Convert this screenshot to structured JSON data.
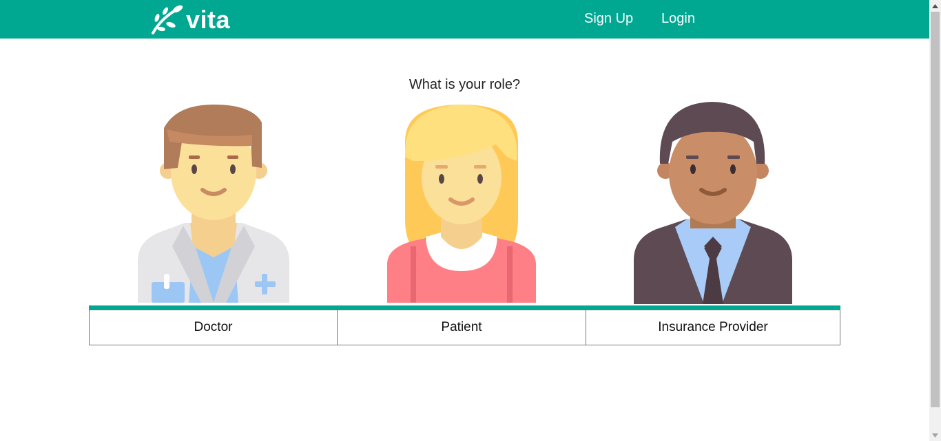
{
  "header": {
    "brand": "vita",
    "nav": {
      "signup_label": "Sign Up",
      "login_label": "Login"
    }
  },
  "main": {
    "question": "What is your role?",
    "roles": [
      {
        "label": "Doctor",
        "icon": "doctor-avatar-icon"
      },
      {
        "label": "Patient",
        "icon": "patient-avatar-icon"
      },
      {
        "label": "Insurance Provider",
        "icon": "insurance-provider-avatar-icon"
      }
    ]
  },
  "colors": {
    "brand": "#00a791",
    "background": "#ffffff"
  }
}
